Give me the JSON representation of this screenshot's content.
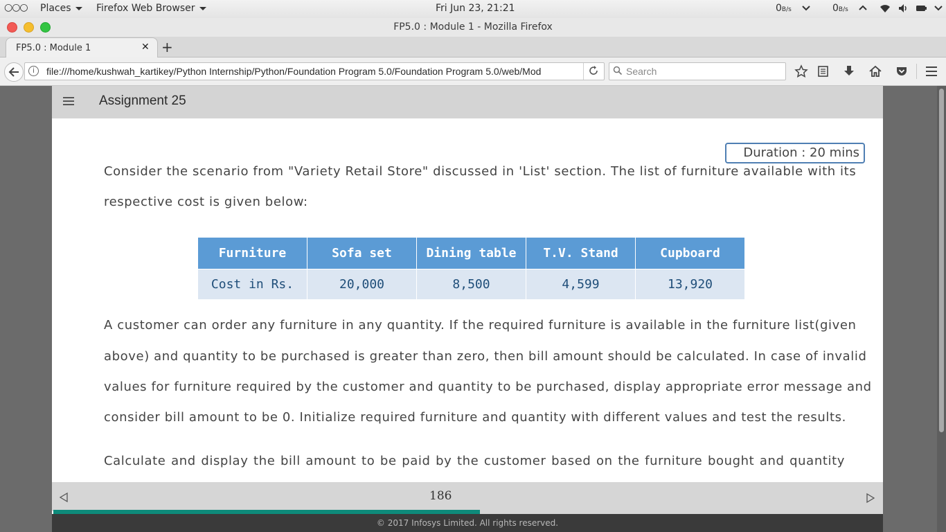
{
  "topbar": {
    "places_label": "Places",
    "app_label": "Firefox Web Browser",
    "clock": "Fri Jun 23, 21:21",
    "net_down_value": "0",
    "net_down_unit": "B/s",
    "net_up_value": "0",
    "net_up_unit": "B/s"
  },
  "window": {
    "title": "FP5.0 : Module 1 - Mozilla Firefox"
  },
  "tabs": [
    {
      "label": "FP5.0 : Module 1"
    }
  ],
  "navbar": {
    "url": "file:///home/kushwah_kartikey/Python Internship/Python/Foundation Program 5.0/Foundation Program 5.0/web/Mod",
    "search_placeholder": "Search"
  },
  "header": {
    "title": "Assignment 25"
  },
  "duration_badge": "Duration : 20 mins",
  "intro_lines": [
    "Consider the scenario from \"Variety Retail Store\" discussed in 'List' section. The list of furniture available with its",
    "respective cost is given below:"
  ],
  "furniture_table": {
    "headers": [
      "Furniture",
      "Sofa set",
      "Dining table",
      "T.V. Stand",
      "Cupboard"
    ],
    "row": [
      "Cost in Rs.",
      "20,000",
      "8,500",
      "4,599",
      "13,920"
    ]
  },
  "body_lines": [
    "A customer can order any furniture in any quantity. If the required furniture is available in the furniture list(given",
    "above) and quantity to be purchased is greater than zero, then bill amount should be calculated. In case of invalid",
    "values for furniture required by the customer and quantity to be purchased, display appropriate error message and",
    "consider bill amount to be 0. Initialize required furniture and quantity with different values and test the results."
  ],
  "tail_line": "Calculate and display the bill amount to be paid by the customer based on the furniture bought and quantity",
  "pagination": {
    "page_number": "186",
    "progress_fraction": 0.514
  },
  "footer": "© 2017 Infosys Limited. All rights reserved.",
  "colors": {
    "table_header": "#5b9bd5",
    "table_row": "#dce6f2",
    "progress": "#0e8a7a",
    "duration_border": "#4f7fb3"
  }
}
